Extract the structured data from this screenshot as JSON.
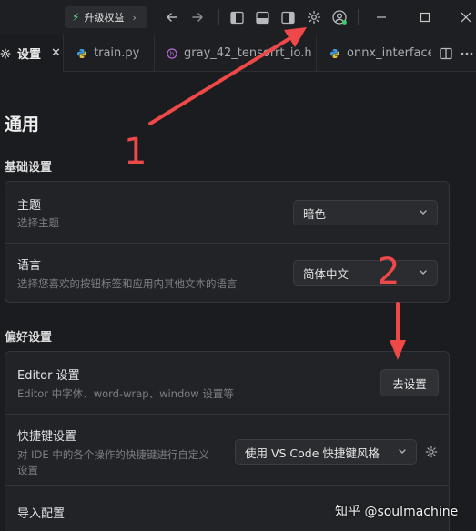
{
  "titlebar": {
    "upgrade_label": "升级权益"
  },
  "tabs": [
    {
      "label": "设置",
      "active": true
    },
    {
      "label": "train.py"
    },
    {
      "label": "gray_42_tensorrt_io.h"
    },
    {
      "label": "onnx_interface.p"
    }
  ],
  "settings": {
    "page_title": "通用",
    "basic": {
      "title": "基础设置",
      "theme": {
        "label": "主题",
        "desc": "选择主题",
        "value": "暗色"
      },
      "language": {
        "label": "语言",
        "desc": "选择您喜欢的按钮标签和应用内其他文本的语言",
        "value": "简体中文"
      }
    },
    "prefs": {
      "title": "偏好设置",
      "editor": {
        "label": "Editor 设置",
        "desc": "Editor 中字体、word-wrap、window 设置等",
        "button": "去设置"
      },
      "shortcuts": {
        "label": "快捷键设置",
        "desc_line1": "对 IDE 中的各个操作的快捷键进行自定义",
        "desc_line2": "设置",
        "value": "使用 VS Code 快捷键风格"
      },
      "import": {
        "label": "导入配置"
      }
    }
  },
  "annotations": {
    "one": "1",
    "two": "2"
  },
  "watermark": "知乎 @soulmachine",
  "colors": {
    "accent_red": "#ee4848",
    "bolt_green": "#5fdc8a",
    "background": "#1b1c1f"
  }
}
